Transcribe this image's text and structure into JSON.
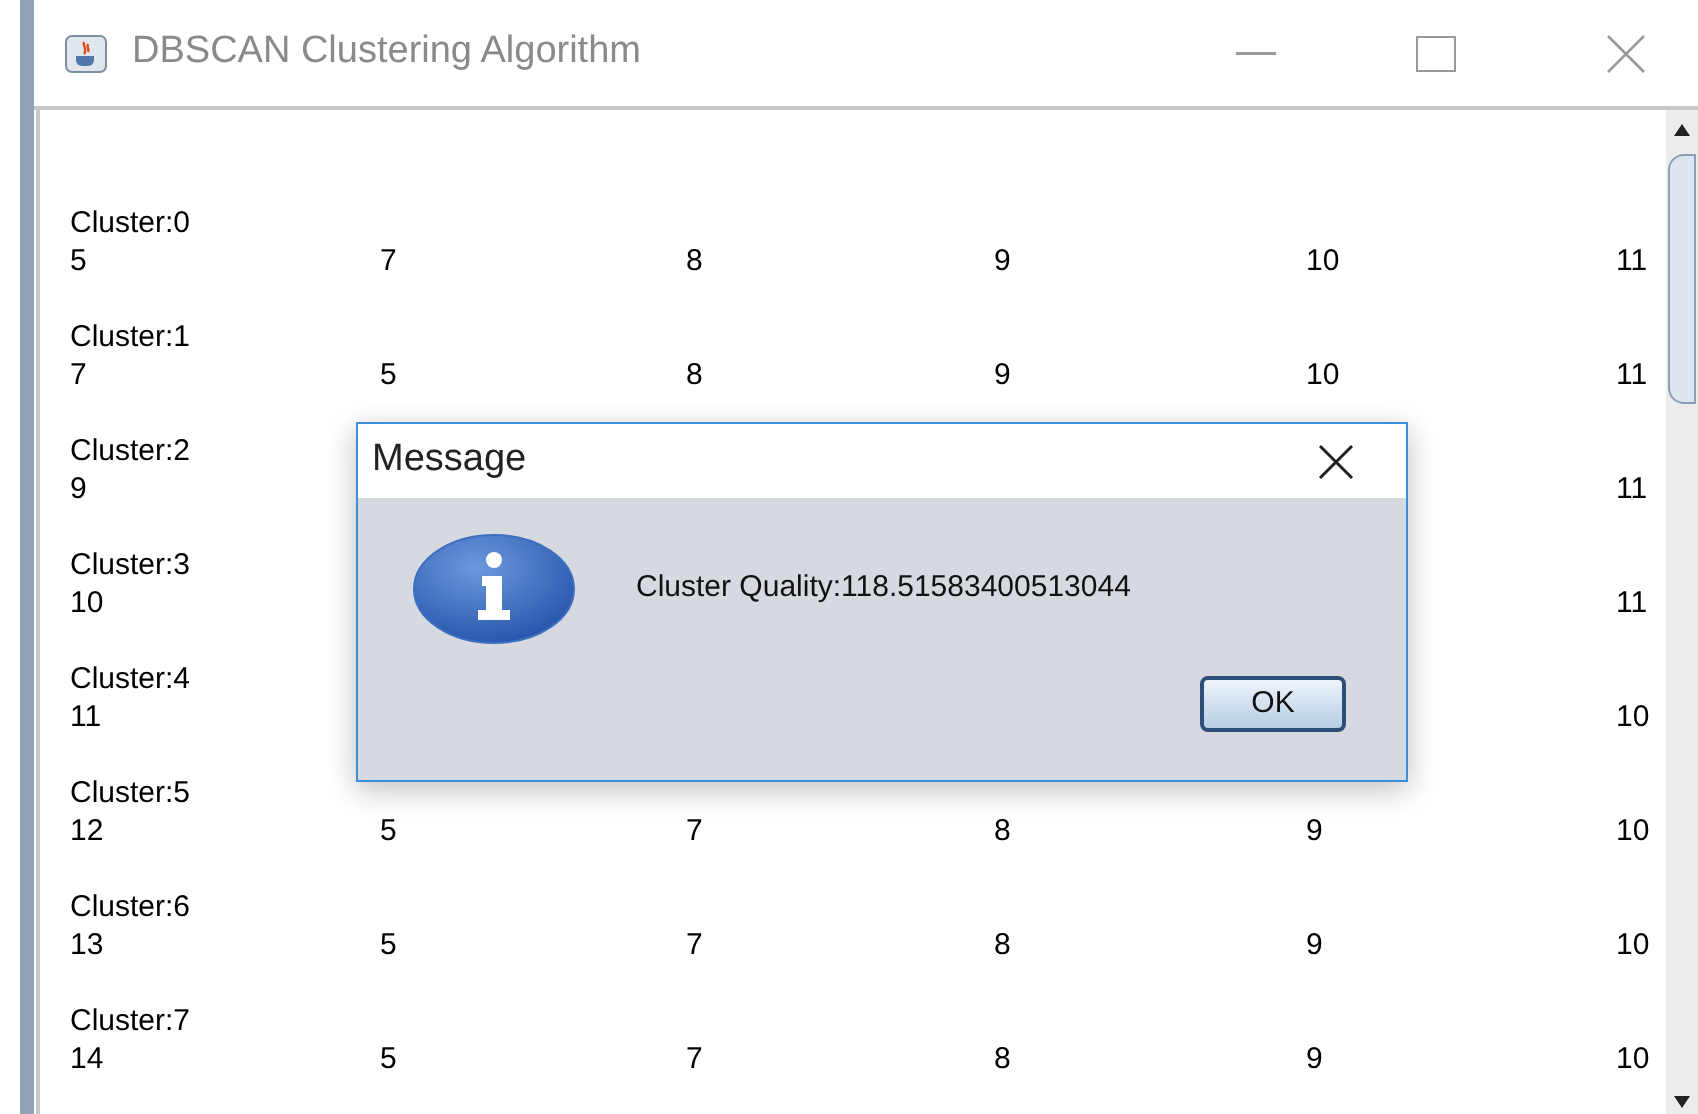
{
  "window": {
    "title": "DBSCAN Clustering Algorithm"
  },
  "clusters": [
    {
      "label": "Cluster:0",
      "values": [
        "5",
        "7",
        "8",
        "9",
        "10",
        "11"
      ]
    },
    {
      "label": "Cluster:1",
      "values": [
        "7",
        "5",
        "8",
        "9",
        "10",
        "11"
      ]
    },
    {
      "label": "Cluster:2",
      "covered": true,
      "values": [
        "9",
        "11"
      ]
    },
    {
      "label": "Cluster:3",
      "covered": true,
      "values": [
        "10",
        "11"
      ]
    },
    {
      "label": "Cluster:4",
      "covered": true,
      "values": [
        "11",
        "10"
      ]
    },
    {
      "label": "Cluster:5",
      "values": [
        "12",
        "5",
        "7",
        "8",
        "9",
        "10"
      ]
    },
    {
      "label": "Cluster:6",
      "values": [
        "13",
        "5",
        "7",
        "8",
        "9",
        "10"
      ]
    },
    {
      "label": "Cluster:7",
      "values": [
        "14",
        "5",
        "7",
        "8",
        "9",
        "10"
      ]
    }
  ],
  "dialog": {
    "title": "Message",
    "message": "Cluster Quality:118.51583400513044",
    "button": "OK"
  }
}
